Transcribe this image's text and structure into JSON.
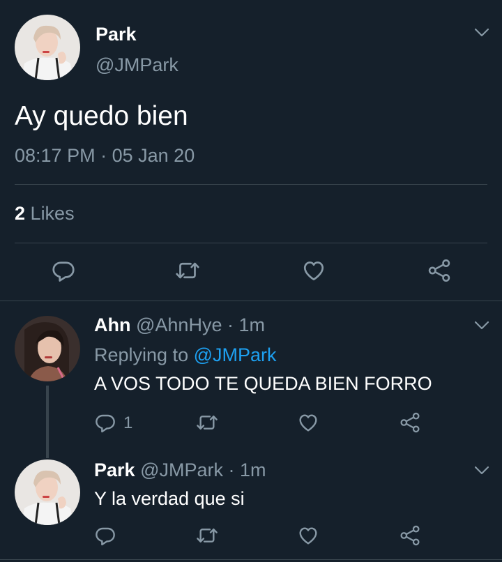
{
  "main_tweet": {
    "name": "Park",
    "handle": "@JMPark",
    "text": "Ay quedo bien",
    "time": "08:17 PM",
    "separator": "·",
    "date": "05 Jan 20",
    "likes_count": "2",
    "likes_label": "Likes"
  },
  "replies": [
    {
      "name": "Ahn",
      "handle": "@AhnHye",
      "dot": "·",
      "age": "1m",
      "replying_prefix": "Replying to",
      "replying_to": "@JMPark",
      "text": "A VOS TODO TE QUEDA BIEN FORRO",
      "reply_count": "1"
    },
    {
      "name": "Park",
      "handle": "@JMPark",
      "dot": "·",
      "age": "1m",
      "text": "Y la verdad que si"
    }
  ],
  "colors": {
    "background": "#15202b",
    "primary_text": "#ffffff",
    "secondary_text": "#8899a6",
    "divider": "#38444d",
    "link": "#1da1f2"
  },
  "icons": [
    "chevron-down-icon",
    "reply-icon",
    "retweet-icon",
    "like-icon",
    "share-icon"
  ]
}
